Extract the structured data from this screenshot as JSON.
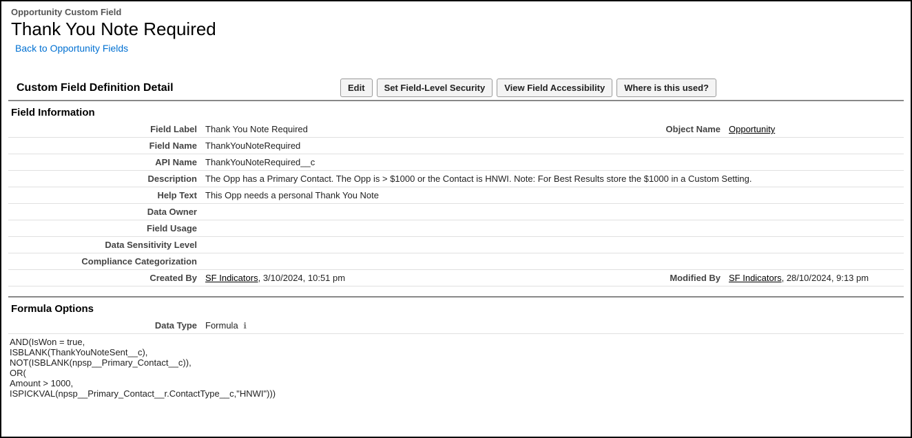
{
  "header": {
    "objectType": "Opportunity Custom Field",
    "pageTitle": "Thank You Note Required",
    "backLink": "Back to Opportunity Fields"
  },
  "detailHeader": {
    "title": "Custom Field Definition Detail",
    "buttons": {
      "edit": "Edit",
      "setFLS": "Set Field-Level Security",
      "viewAccess": "View Field Accessibility",
      "whereUsed": "Where is this used?"
    }
  },
  "sections": {
    "fieldInfo": "Field Information",
    "formulaOptions": "Formula Options"
  },
  "labels": {
    "fieldLabel": "Field Label",
    "objectName": "Object Name",
    "fieldName": "Field Name",
    "apiName": "API Name",
    "description": "Description",
    "helpText": "Help Text",
    "dataOwner": "Data Owner",
    "fieldUsage": "Field Usage",
    "dataSensitivity": "Data Sensitivity Level",
    "compliance": "Compliance Categorization",
    "createdBy": "Created By",
    "modifiedBy": "Modified By",
    "dataType": "Data Type"
  },
  "values": {
    "fieldLabel": "Thank You Note Required",
    "objectName": "Opportunity",
    "fieldName": "ThankYouNoteRequired",
    "apiName": "ThankYouNoteRequired__c",
    "description": "The Opp has a Primary Contact. The Opp is > $1000 or the Contact is HNWI. Note: For Best Results store the $1000 in a Custom Setting.",
    "helpText": "This Opp needs a personal Thank You Note",
    "dataOwner": "",
    "fieldUsage": "",
    "dataSensitivity": "",
    "compliance": "",
    "createdByUser": "SF Indicators",
    "createdBySuffix": ", 3/10/2024, 10:51 pm",
    "modifiedByUser": "SF Indicators",
    "modifiedBySuffix": ", 28/10/2024, 9:13 pm",
    "dataType": "Formula",
    "formula": "AND(IsWon = true,\nISBLANK(ThankYouNoteSent__c),\nNOT(ISBLANK(npsp__Primary_Contact__c)),\nOR(\nAmount > 1000,\nISPICKVAL(npsp__Primary_Contact__r.ContactType__c,\"HNWI\")))"
  }
}
